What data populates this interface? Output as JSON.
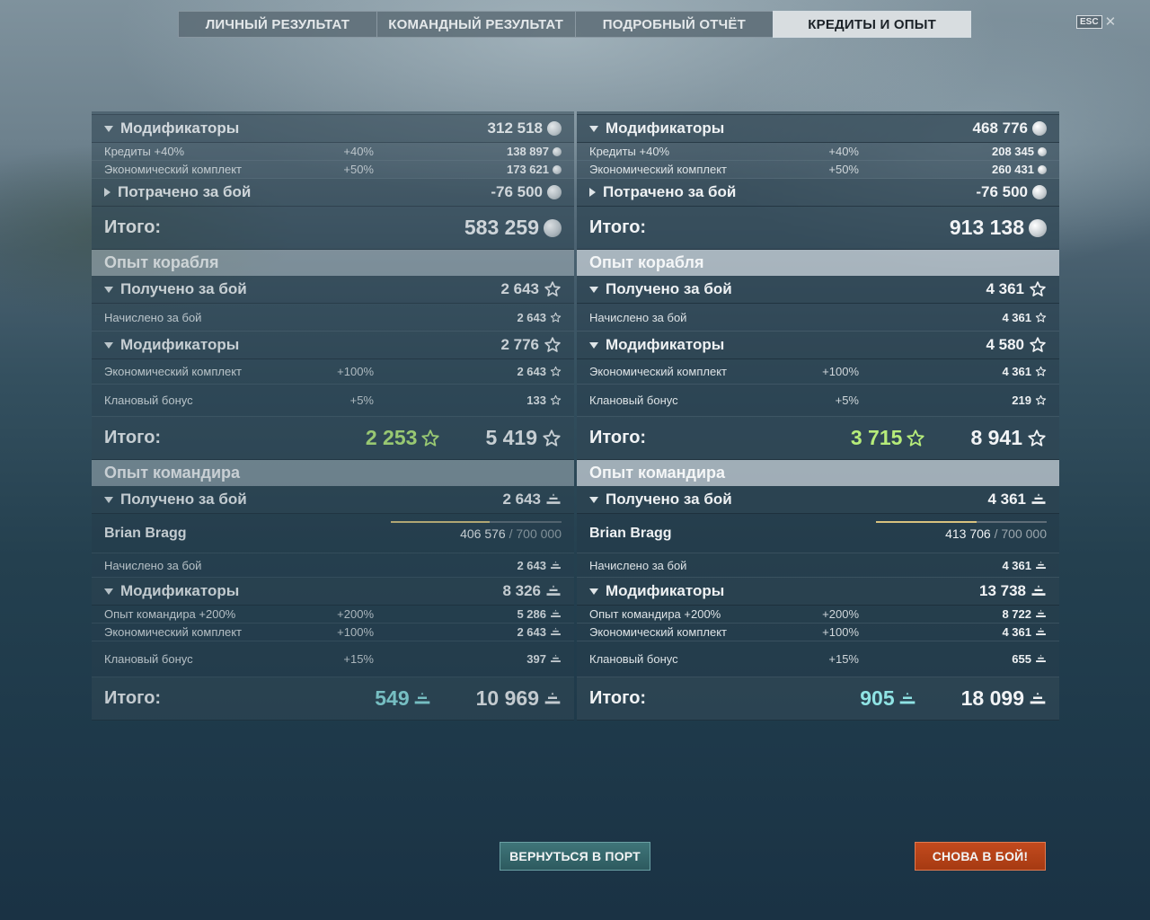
{
  "tabs": [
    {
      "label": "ЛИЧНЫЙ РЕЗУЛЬТАТ"
    },
    {
      "label": "КОМАНДНЫЙ РЕЗУЛЬТАТ"
    },
    {
      "label": "ПОДРОБНЫЙ ОТЧЁТ"
    },
    {
      "label": "КРЕДИТЫ И ОПЫТ"
    }
  ],
  "active_tab": "КРЕДИТЫ И ОПЫТ",
  "esc_label": "ESC",
  "close_glyph": "✕",
  "labels": {
    "modifiers": "Модификаторы",
    "credits_bonus": "Кредиты +40%",
    "economic_kit": "Экономический комплект",
    "spent": "Потрачено за бой",
    "total": "Итого:",
    "ship_xp": "Опыт корабля",
    "received": "Получено за бой",
    "accrued": "Начислено за бой",
    "clan_bonus": "Клановый бонус",
    "commander_xp": "Опыт командира",
    "commander_bonus": "Опыт командира +200%"
  },
  "icons": {
    "credits": "credits-icon",
    "ship_xp": "star-icon",
    "commander_xp": "commander-xp-icon"
  },
  "colors": {
    "premium_ship_xp": "#b6ec7a",
    "premium_commander_xp": "#8fe3e4",
    "return_button": "#2d5a5f",
    "battle_button": "#a63a12"
  },
  "left": {
    "credits": {
      "modifiers_total": "312 518",
      "credits_bonus_pct": "+40%",
      "credits_bonus_value": "138 897",
      "economic_pct": "+50%",
      "economic_value": "173 621",
      "spent_value": "-76 500",
      "total": "583 259"
    },
    "ship": {
      "received": "2 643",
      "accrued": "2 643",
      "modifiers_total": "2 776",
      "economic_pct": "+100%",
      "economic_value": "2 643",
      "clan_pct": "+5%",
      "clan_value": "133",
      "total_premium": "2 253",
      "total": "5 419"
    },
    "commander": {
      "received": "2 643",
      "name": "Brian Bragg",
      "xp_current": "406 576",
      "xp_max": "/ 700 000",
      "xp_progress": 0.58,
      "accrued": "2 643",
      "modifiers_total": "8 326",
      "bonus_pct": "+200%",
      "bonus_value": "5 286",
      "economic_pct": "+100%",
      "economic_value": "2 643",
      "clan_pct": "+15%",
      "clan_value": "397",
      "total_premium": "549",
      "total": "10 969"
    }
  },
  "right": {
    "credits": {
      "modifiers_total": "468 776",
      "credits_bonus_pct": "+40%",
      "credits_bonus_value": "208 345",
      "economic_pct": "+50%",
      "economic_value": "260 431",
      "spent_value": "-76 500",
      "total": "913 138"
    },
    "ship": {
      "received": "4 361",
      "accrued": "4 361",
      "modifiers_total": "4 580",
      "economic_pct": "+100%",
      "economic_value": "4 361",
      "clan_pct": "+5%",
      "clan_value": "219",
      "total_premium": "3 715",
      "total": "8 941"
    },
    "commander": {
      "received": "4 361",
      "name": "Brian Bragg",
      "xp_current": "413 706",
      "xp_max": "/ 700 000",
      "xp_progress": 0.59,
      "accrued": "4 361",
      "modifiers_total": "13 738",
      "bonus_pct": "+200%",
      "bonus_value": "8 722",
      "economic_pct": "+100%",
      "economic_value": "4 361",
      "clan_pct": "+15%",
      "clan_value": "655",
      "total_premium": "905",
      "total": "18 099"
    }
  },
  "buttons": {
    "return_to_port": "ВЕРНУТЬСЯ В ПОРТ",
    "to_battle": "СНОВА В БОЙ!"
  }
}
